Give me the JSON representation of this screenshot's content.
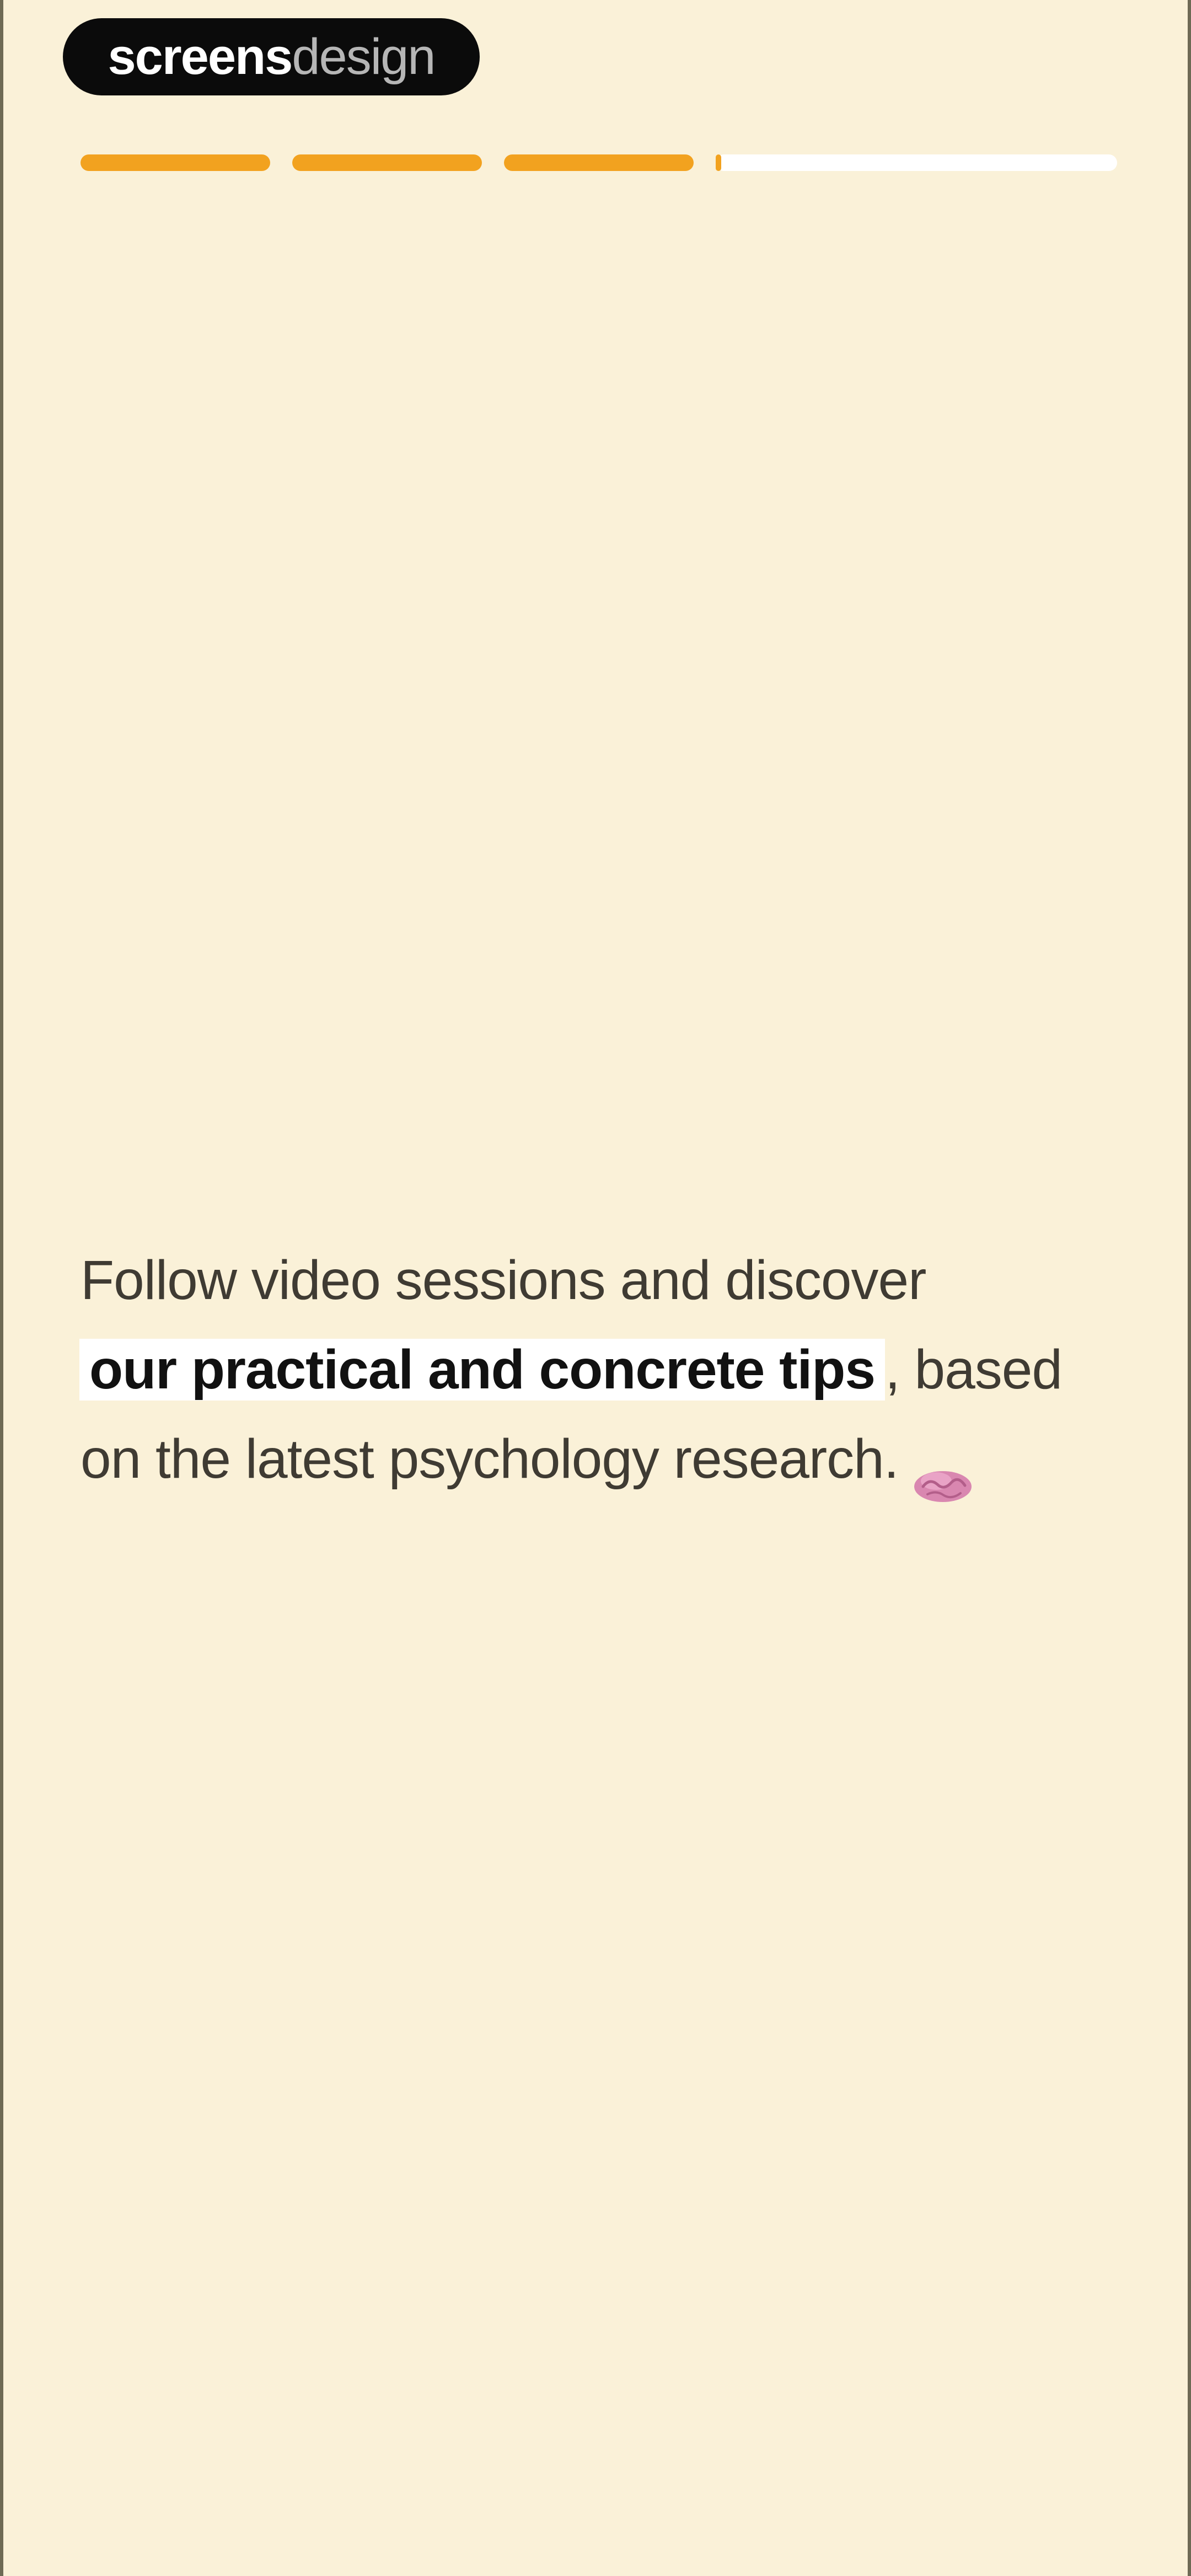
{
  "brand": {
    "strong": "screens",
    "light": "design"
  },
  "progress": {
    "segments": [
      {
        "fill": 1.0
      },
      {
        "fill": 1.0
      },
      {
        "fill": 1.0
      },
      {
        "fill": 0.02
      },
      {
        "fill": 0.0
      }
    ],
    "colors": {
      "active": "#F2A21F",
      "inactive": "#FFFFFF"
    }
  },
  "content": {
    "line1": "Follow video sessions and discover",
    "highlight": "our practical and concrete tips",
    "line2_rest": ", based",
    "line3": "on the latest psychology research.",
    "icon": "brain-icon"
  }
}
